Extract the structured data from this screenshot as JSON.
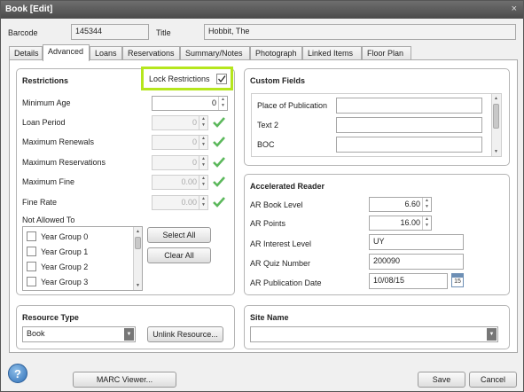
{
  "window": {
    "title": "Book [Edit]",
    "close_glyph": "×"
  },
  "header": {
    "barcode_label": "Barcode",
    "barcode_value": "145344",
    "title_label": "Title",
    "title_value": "Hobbit, The"
  },
  "tabs": [
    {
      "label": "Details"
    },
    {
      "label": "Advanced"
    },
    {
      "label": "Loans"
    },
    {
      "label": "Reservations"
    },
    {
      "label": "Summary/Notes"
    },
    {
      "label": "Photograph"
    },
    {
      "label": "Linked Items"
    },
    {
      "label": "Floor Plan"
    }
  ],
  "restrictions": {
    "title": "Restrictions",
    "lock_label": "Lock Restrictions",
    "lock_checked": true,
    "rows": [
      {
        "label": "Minimum Age",
        "value": "0"
      },
      {
        "label": "Loan Period",
        "value": "0"
      },
      {
        "label": "Maximum Renewals",
        "value": "0"
      },
      {
        "label": "Maximum Reservations",
        "value": "0"
      },
      {
        "label": "Maximum Fine",
        "value": "0.00"
      },
      {
        "label": "Fine Rate",
        "value": "0.00"
      }
    ],
    "not_allowed_label": "Not Allowed To",
    "groups": [
      "Year Group 0",
      "Year Group 1",
      "Year Group 2",
      "Year Group 3"
    ],
    "select_all": "Select All",
    "clear_all": "Clear All"
  },
  "custom_fields": {
    "title": "Custom Fields",
    "fields": [
      {
        "label": "Place of Publication",
        "value": ""
      },
      {
        "label": "Text 2",
        "value": ""
      },
      {
        "label": "BOC",
        "value": ""
      }
    ]
  },
  "accelerated_reader": {
    "title": "Accelerated Reader",
    "book_level_label": "AR Book Level",
    "book_level": "6.60",
    "points_label": "AR Points",
    "points": "16.00",
    "interest_label": "AR Interest Level",
    "interest": "UY",
    "quiz_label": "AR Quiz Number",
    "quiz": "200090",
    "pubdate_label": "AR Publication Date",
    "pubdate": "10/08/15",
    "calendar_day": "15"
  },
  "resource_type": {
    "title": "Resource Type",
    "value": "Book",
    "unlink": "Unlink Resource..."
  },
  "site_name": {
    "title": "Site Name",
    "value": ""
  },
  "footer": {
    "help": "?",
    "marc": "MARC Viewer...",
    "save": "Save",
    "cancel": "Cancel"
  },
  "colors": {
    "lock_highlight": "#b5e61d",
    "check_green": "#5cb85c"
  }
}
